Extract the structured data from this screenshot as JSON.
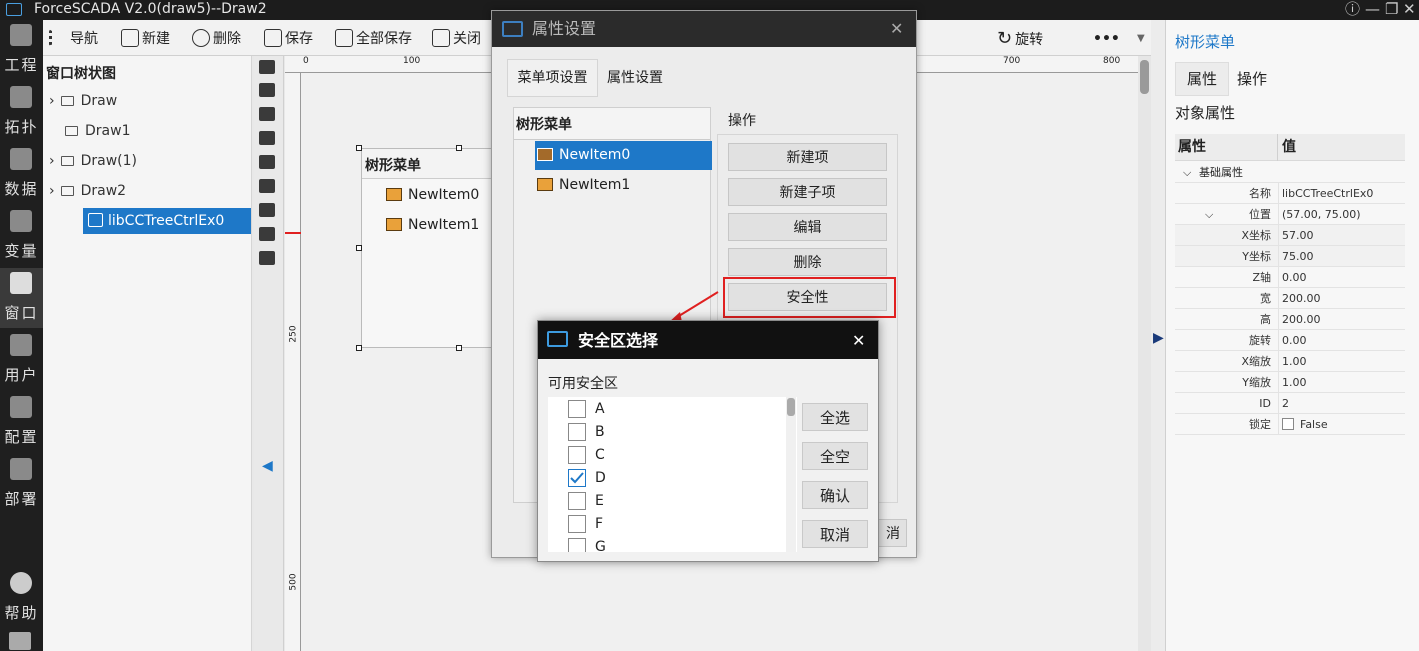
{
  "app": {
    "title": "ForceSCADA V2.0(draw5)--Draw2"
  },
  "leftnav": [
    {
      "label": "工程",
      "icon": "grid-icon"
    },
    {
      "label": "拓扑",
      "icon": "topology-icon"
    },
    {
      "label": "数据",
      "icon": "database-icon"
    },
    {
      "label": "变量",
      "icon": "variable-icon"
    },
    {
      "label": "窗口",
      "icon": "window-icon"
    },
    {
      "label": "用户",
      "icon": "user-icon"
    },
    {
      "label": "配置",
      "icon": "config-icon"
    },
    {
      "label": "部署",
      "icon": "deploy-icon"
    },
    {
      "label": "帮助",
      "icon": "help-icon"
    }
  ],
  "toolbar": {
    "nav": "导航",
    "new": "新建",
    "delete": "删除",
    "save": "保存",
    "save_all": "全部保存",
    "close": "关闭",
    "rotate": "旋转",
    "more": "•••"
  },
  "tree": {
    "title": "窗口树状图",
    "nodes": [
      "Draw",
      "Draw1",
      "Draw(1)",
      "Draw2",
      "libCCTreeCtrlEx0"
    ]
  },
  "ruler": {
    "top": [
      "0",
      "100",
      "700",
      "800"
    ],
    "left": [
      "250",
      "500"
    ]
  },
  "canvas_widget": {
    "header": "树形菜单",
    "items": [
      "NewItem0",
      "NewItem1"
    ]
  },
  "right": {
    "title": "树形菜单",
    "tab_props": "属性",
    "tab_ops": "操作",
    "section": "对象属性",
    "col_key": "属性",
    "col_val": "值",
    "group": "基础属性",
    "rows": [
      {
        "k": "名称",
        "v": "libCCTreeCtrlEx0"
      },
      {
        "k": "位置",
        "v": "(57.00, 75.00)"
      },
      {
        "k": "X坐标",
        "v": "57.00"
      },
      {
        "k": "Y坐标",
        "v": "75.00"
      },
      {
        "k": "Z轴",
        "v": "0.00"
      },
      {
        "k": "宽",
        "v": "200.00"
      },
      {
        "k": "高",
        "v": "200.00"
      },
      {
        "k": "旋转",
        "v": "0.00"
      },
      {
        "k": "X缩放",
        "v": "1.00"
      },
      {
        "k": "Y缩放",
        "v": "1.00"
      },
      {
        "k": "ID",
        "v": "2"
      },
      {
        "k": "锁定",
        "v": "False"
      }
    ]
  },
  "prop_dialog": {
    "title": "属性设置",
    "tab_menu": "菜单项设置",
    "tab_prop": "属性设置",
    "tree_header": "树形菜单",
    "items": [
      "NewItem0",
      "NewItem1"
    ],
    "ops_label": "操作",
    "buttons": [
      "新建项",
      "新建子项",
      "编辑",
      "删除",
      "安全性"
    ],
    "cancel_partial": "消"
  },
  "security_dialog": {
    "title": "安全区选择",
    "label": "可用安全区",
    "zones": [
      {
        "name": "A",
        "checked": false
      },
      {
        "name": "B",
        "checked": false
      },
      {
        "name": "C",
        "checked": false
      },
      {
        "name": "D",
        "checked": true
      },
      {
        "name": "E",
        "checked": false
      },
      {
        "name": "F",
        "checked": false
      },
      {
        "name": "G",
        "checked": false
      }
    ],
    "btn_select_all": "全选",
    "btn_clear": "全空",
    "btn_ok": "确认",
    "btn_cancel": "取消"
  },
  "colors": {
    "accent": "#1e78c8",
    "annotation": "#e02020",
    "check": "#1e78c8"
  }
}
